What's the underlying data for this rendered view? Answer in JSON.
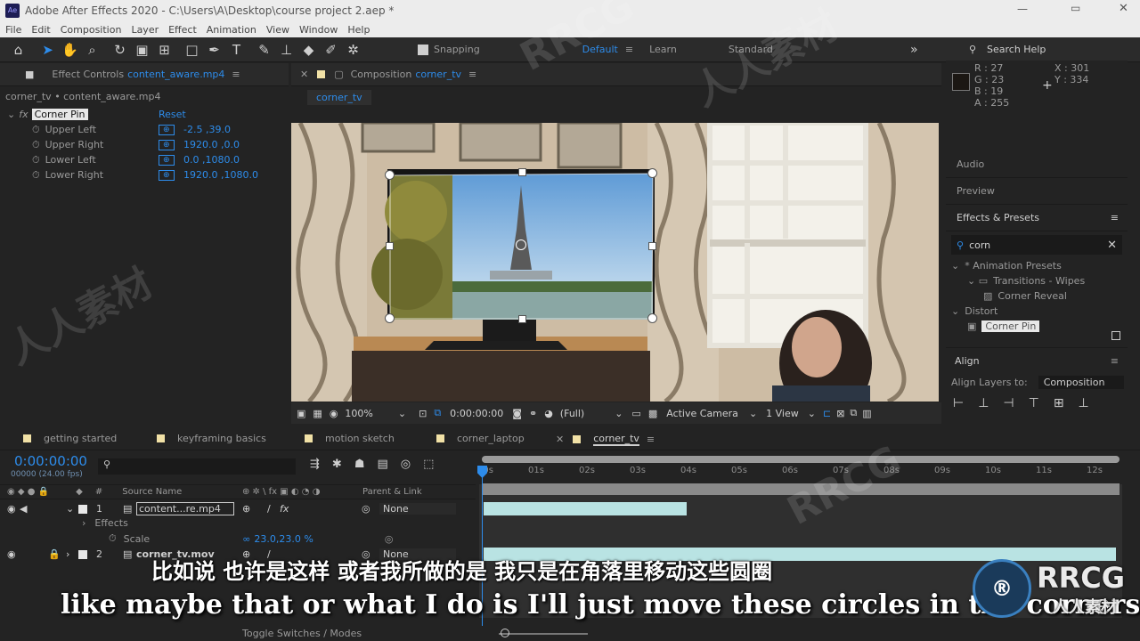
{
  "window": {
    "title": "Adobe After Effects 2020 - C:\\Users\\A\\Desktop\\course project 2.aep *",
    "app_badge": "Ae"
  },
  "menu": [
    "File",
    "Edit",
    "Composition",
    "Layer",
    "Effect",
    "Animation",
    "View",
    "Window",
    "Help"
  ],
  "toolbar": {
    "snapping_label": "Snapping",
    "workspaces": [
      "Default",
      "Learn",
      "Standard"
    ],
    "search_help": "Search Help"
  },
  "effect_controls": {
    "tab_label": "Effect Controls",
    "tab_file": "content_aware.mp4",
    "breadcrumb": "corner_tv • content_aware.mp4",
    "effect_name": "Corner Pin",
    "reset_label": "Reset",
    "params": [
      {
        "name": "Upper Left",
        "value": "-2.5 ,39.0"
      },
      {
        "name": "Upper Right",
        "value": "1920.0 ,0.0"
      },
      {
        "name": "Lower Left",
        "value": "0.0 ,1080.0"
      },
      {
        "name": "Lower Right",
        "value": "1920.0 ,1080.0"
      }
    ]
  },
  "composition": {
    "tab_label": "Composition",
    "tab_name": "corner_tv",
    "sub_tab": "corner_tv",
    "zoom": "100%",
    "timecode": "0:00:00:00",
    "resolution": "(Full)",
    "camera": "Active Camera",
    "views": "1 View"
  },
  "info": {
    "R": "27",
    "G": "23",
    "B": "19",
    "A": "255",
    "X": "301",
    "Y": "334"
  },
  "right_panels": {
    "audio": "Audio",
    "preview": "Preview",
    "effects_presets": "Effects & Presets",
    "search_value": "corn",
    "tree": [
      {
        "label": "* Animation Presets",
        "indent": 0
      },
      {
        "label": "Transitions - Wipes",
        "indent": 1
      },
      {
        "label": "Corner Reveal",
        "indent": 2
      },
      {
        "label": "Distort",
        "indent": 0
      },
      {
        "label": "Corner Pin",
        "indent": 1
      }
    ],
    "align": "Align",
    "align_to_label": "Align Layers to:",
    "align_to_value": "Composition"
  },
  "timeline": {
    "tabs": [
      "getting started",
      "keyframing basics",
      "motion sketch",
      "corner_laptop",
      "corner_tv"
    ],
    "timecode": "0:00:00:00",
    "fps": "00000 (24.00 fps)",
    "col_source": "Source Name",
    "col_parent": "Parent & Link",
    "ruler": [
      "00s",
      "01s",
      "02s",
      "03s",
      "04s",
      "05s",
      "06s",
      "07s",
      "08s",
      "09s",
      "10s",
      "11s",
      "12s"
    ],
    "layers": [
      {
        "num": "1",
        "name": "content...re.mp4",
        "parent": "None"
      },
      {
        "num": "2",
        "name": "corner_tv.mov",
        "parent": "None"
      }
    ],
    "effects_label": "Effects",
    "scale_label": "Scale",
    "scale_value": "23.0,23.0 %",
    "toggle_label": "Toggle Switches / Modes"
  },
  "subtitles": {
    "cn": "比如说 也许是这样 或者我所做的是 我只是在角落里移动这些圆圈",
    "en": "like maybe that or what I do is I'll just move these circles in the corners."
  },
  "watermark": {
    "brand": "RRCG",
    "cn": "人人素材"
  },
  "colors": {
    "accent": "#2d8ceb",
    "layer_bar": "#b9e3e3",
    "label_yellow": "#f1e1a6"
  }
}
